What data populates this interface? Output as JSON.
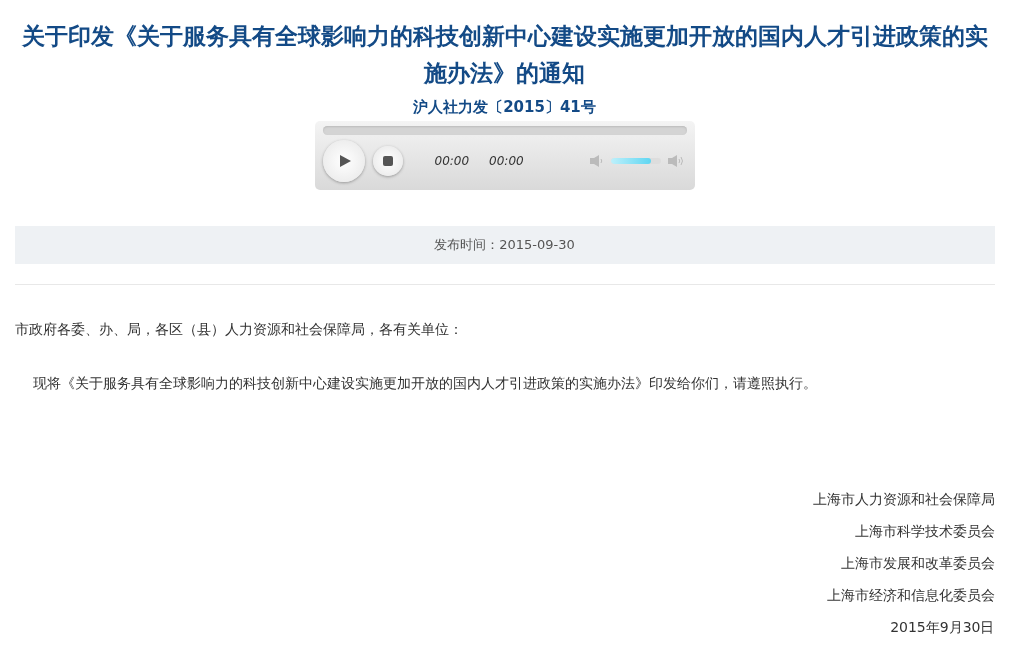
{
  "title": "关于印发《关于服务具有全球影响力的科技创新中心建设实施更加开放的国内人才引进政策的实施办法》的通知",
  "doc_number": "沪人社力发〔2015〕41号",
  "player": {
    "current_time": "00:00",
    "duration": "00:00",
    "volume": {
      "level": 0.8
    }
  },
  "publish_date": "发布时间：2015-09-30",
  "body": {
    "salutation": "市政府各委、办、局，各区（县）人力资源和社会保障局，各有关单位：",
    "paragraphs": [
      "现将《关于服务具有全球影响力的科技创新中心建设实施更加开放的国内人才引进政策的实施办法》印发给你们，请遵照执行。"
    ]
  },
  "signatures": [
    "上海市人力资源和社会保障局",
    "上海市科学技术委员会",
    "上海市发展和改革委员会",
    "上海市经济和信息化委员会"
  ],
  "date": "2015年9月30日"
}
